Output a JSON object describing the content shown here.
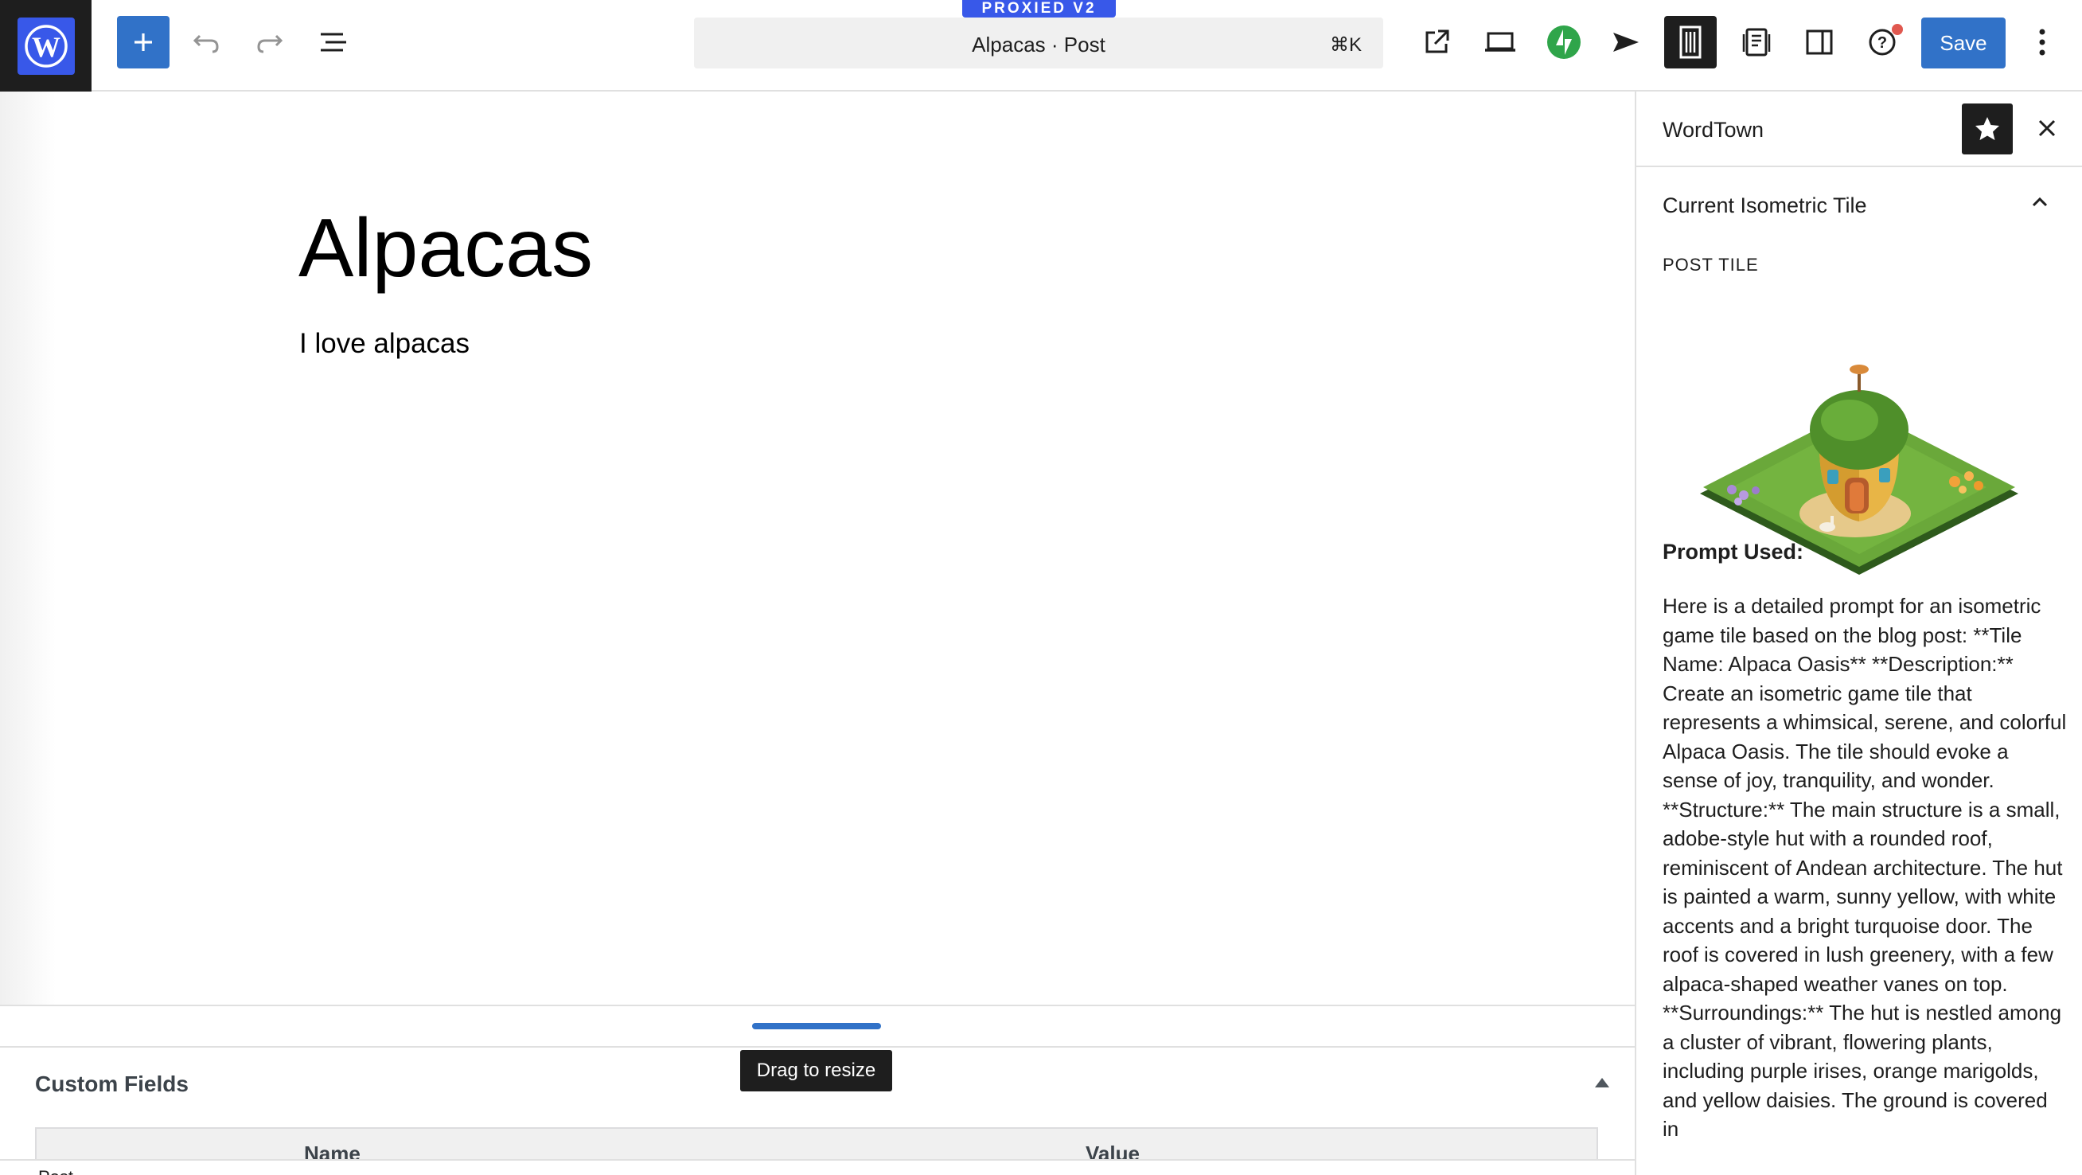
{
  "toolbar": {
    "document_title": "Alpacas · Post",
    "shortcut": "⌘K",
    "environment_badge": "PROXIED V2",
    "save_label": "Save",
    "accent_color": "#3172c8",
    "icons": [
      "wordpress-logo-icon",
      "plus-icon",
      "undo-icon",
      "redo-icon",
      "document-overview-icon",
      "external-link-icon",
      "desktop-preview-icon",
      "jetpack-icon",
      "send-icon",
      "wordtown-building-icon",
      "revisions-icon",
      "settings-sidebar-icon",
      "help-icon",
      "more-options-icon"
    ]
  },
  "editor": {
    "title": "Alpacas",
    "paragraph": "I love alpacas"
  },
  "resize": {
    "tooltip": "Drag to resize"
  },
  "metabox": {
    "title": "Custom Fields",
    "columns": [
      "Name",
      "Value"
    ]
  },
  "footer": {
    "breadcrumb": "Post"
  },
  "sidebar": {
    "title": "WordTown",
    "panel": {
      "title": "Current Isometric Tile",
      "tile_label": "POST TILE",
      "prompt_label": "Prompt Used:",
      "prompt_text": "Here is a detailed prompt for an isometric game tile based on the blog post: **Tile Name: Alpaca Oasis** **Description:** Create an isometric game tile that represents a whimsical, serene, and colorful Alpaca Oasis. The tile should evoke a sense of joy, tranquility, and wonder. **Structure:** The main structure is a small, adobe-style hut with a rounded roof, reminiscent of Andean architecture. The hut is painted a warm, sunny yellow, with white accents and a bright turquoise door. The roof is covered in lush greenery, with a few alpaca-shaped weather vanes on top. **Surroundings:** The hut is nestled among a cluster of vibrant, flowering plants, including purple irises, orange marigolds, and yellow daisies. The ground is covered in"
    }
  }
}
